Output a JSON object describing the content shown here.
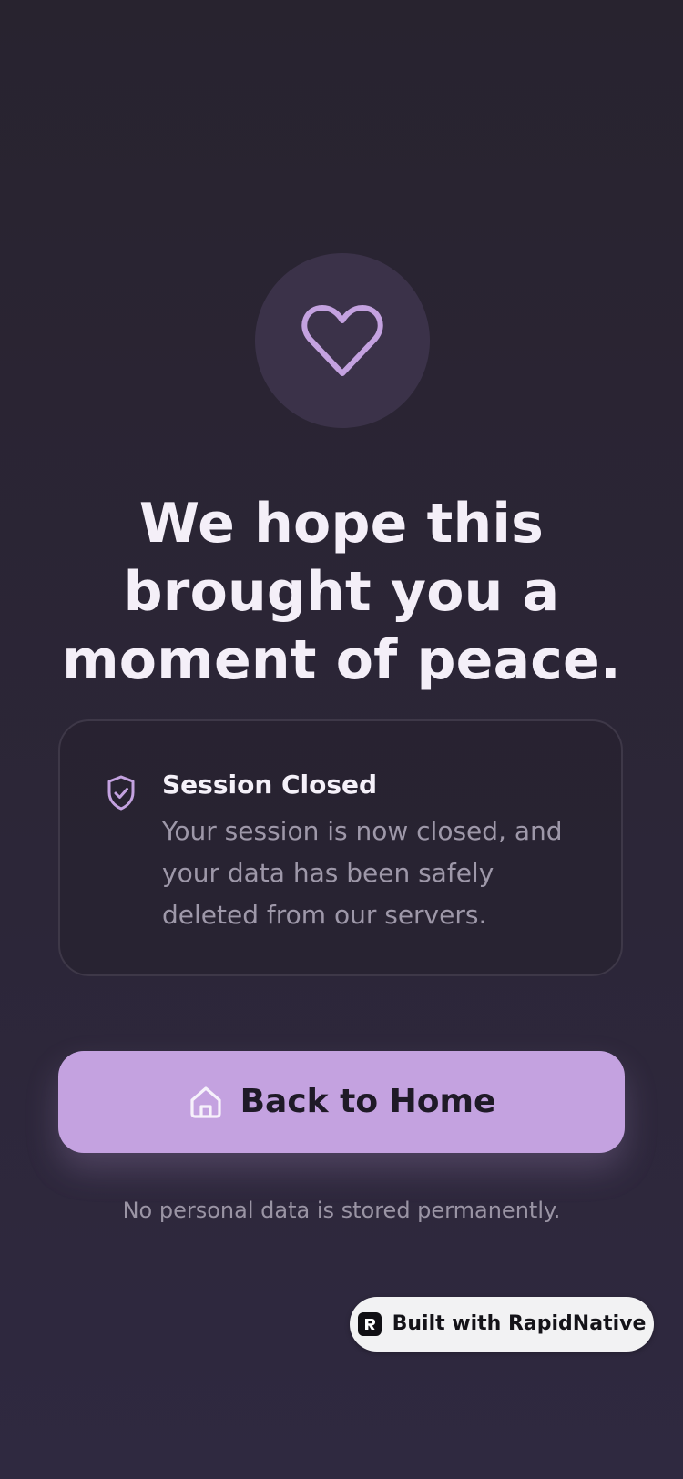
{
  "hero": {
    "icon": "heart-icon",
    "headline": "We hope this brought you a moment of peace."
  },
  "session_card": {
    "icon": "shield-check-icon",
    "title": "Session Closed",
    "body": "Your session is now closed, and your data has been safely deleted from our servers."
  },
  "home_button": {
    "icon": "home-icon",
    "label": "Back to Home"
  },
  "footnote": "No personal data is stored permanently.",
  "badge": {
    "icon": "rapidnative-logo-icon",
    "label": "Built with RapidNative"
  },
  "colors": {
    "background": "#2a2433",
    "accent": "#c4a2e0",
    "heart_circle": "#3b3249",
    "text_primary": "#f4eff8",
    "text_muted": "#9e98a9"
  }
}
